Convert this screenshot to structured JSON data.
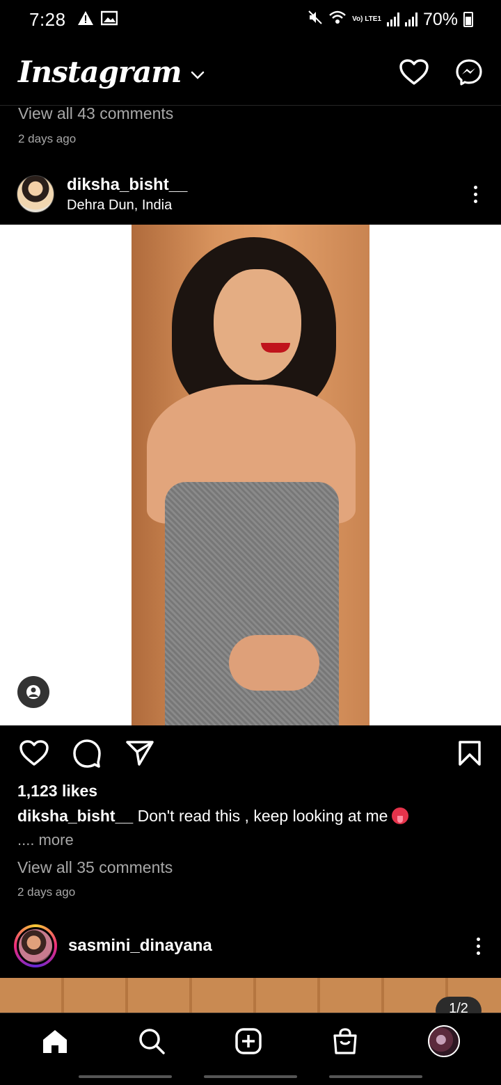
{
  "status_bar": {
    "time": "7:28",
    "battery": "70%",
    "network": "Vo) LTE1",
    "icons": [
      "warning-icon",
      "image-icon",
      "mute-icon",
      "wifi-icon",
      "signal-icon",
      "battery-icon"
    ]
  },
  "app_bar": {
    "logo": "Instagram",
    "icons": [
      "chevron-down-icon",
      "heart-icon",
      "messenger-icon"
    ]
  },
  "previous_post": {
    "view_comments": "View all 43 comments",
    "time": "2 days ago"
  },
  "post": {
    "username": "diksha_bisht__",
    "location": "Dehra Dun, India",
    "likes": "1,123 likes",
    "caption_user": "diksha_bisht__",
    "caption_text": " Don't read this , keep looking at me",
    "more": ".... more",
    "view_comments": "View all 35 comments",
    "time": "2 days ago"
  },
  "next_post": {
    "username": "sasmini_dinayana",
    "counter": "1/2"
  },
  "bottom_nav": {
    "items": [
      "home-icon",
      "search-icon",
      "create-icon",
      "shop-icon",
      "profile-avatar"
    ]
  },
  "colors": {
    "background": "#000000",
    "muted_text": "#a8a8a8",
    "accent_story": "#ee2a7b"
  }
}
